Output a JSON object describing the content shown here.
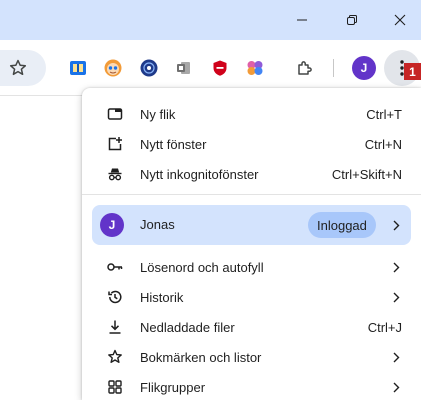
{
  "titlebar": {
    "controls": [
      {
        "name": "minimize-icon",
        "glyph": "minimize"
      },
      {
        "name": "restore-icon",
        "glyph": "restore"
      },
      {
        "name": "close-icon",
        "glyph": "close"
      }
    ]
  },
  "toolbar": {
    "bookmark_icon": "star-outline-icon",
    "extensions": [
      {
        "name": "reading-mode-extension-icon",
        "color": "#1a73e8"
      },
      {
        "name": "face-avatar-extension-icon",
        "color": "#f29b38"
      },
      {
        "name": "blue-badge-extension-icon",
        "color": "#1f3a8a"
      },
      {
        "name": "office-extension-icon",
        "color": "#707070"
      },
      {
        "name": "shield-extension-icon",
        "color": "#d0021b"
      },
      {
        "name": "brain-extension-icon",
        "color": "#b04ac9"
      },
      {
        "name": "puzzle-extensions-icon",
        "color": "#444746"
      }
    ],
    "profile_initial": "J",
    "menu_icon": "three-dot-menu-icon",
    "badge": "1"
  },
  "menu": {
    "items_top": [
      {
        "icon": "new-tab-icon",
        "label": "Ny flik",
        "shortcut": "Ctrl+T"
      },
      {
        "icon": "new-window-icon",
        "label": "Nytt fönster",
        "shortcut": "Ctrl+N"
      },
      {
        "icon": "incognito-icon",
        "label": "Nytt inkognitofönster",
        "shortcut": "Ctrl+Skift+N"
      }
    ],
    "profile": {
      "initial": "J",
      "name": "Jonas",
      "status": "Inloggad"
    },
    "items_bottom": [
      {
        "icon": "key-icon",
        "label": "Lösenord och autofyll",
        "shortcut": "",
        "submenu": true
      },
      {
        "icon": "history-icon",
        "label": "Historik",
        "shortcut": "",
        "submenu": true
      },
      {
        "icon": "download-icon",
        "label": "Nedladdade filer",
        "shortcut": "Ctrl+J",
        "submenu": false
      },
      {
        "icon": "star-icon",
        "label": "Bokmärken och listor",
        "shortcut": "",
        "submenu": true
      },
      {
        "icon": "tab-groups-icon",
        "label": "Flikgrupper",
        "shortcut": "",
        "submenu": true
      }
    ]
  },
  "colors": {
    "titlebar_bg": "#d3e3fd",
    "profile_accent": "#6234c9",
    "badge_red": "#c62525",
    "highlight_row": "#d3e3fd",
    "status_pill": "#a8c7fa"
  }
}
